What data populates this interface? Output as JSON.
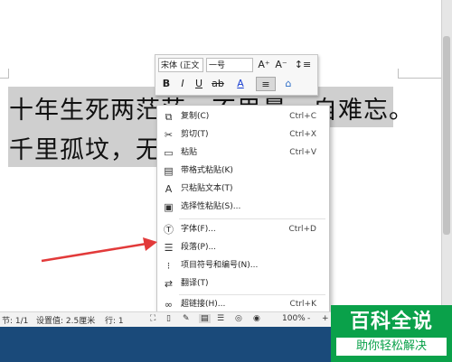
{
  "document": {
    "line1": "十年生死两茫茫，不思量，自难忘。",
    "line2": "千里孤坟，无处话凄凉。"
  },
  "mini_toolbar": {
    "font_name": "宋体 (正文",
    "font_size": "一号",
    "grow_font": "A⁺",
    "shrink_font": "A⁻",
    "bold": "B",
    "italic": "I",
    "underline": "U",
    "strike": "ab",
    "font_color": "A",
    "align": "≡",
    "clear": "⌂"
  },
  "context_menu": {
    "items": [
      {
        "icon": "copy-icon",
        "glyph": "⧉",
        "label": "复制(C)",
        "shortcut": "Ctrl+C"
      },
      {
        "icon": "cut-icon",
        "glyph": "✂",
        "label": "剪切(T)",
        "shortcut": "Ctrl+X"
      },
      {
        "icon": "paste-icon",
        "glyph": "📋",
        "label": "粘贴",
        "shortcut": "Ctrl+V"
      },
      {
        "icon": "paste-with-format-icon",
        "glyph": "▤",
        "label": "带格式粘贴(K)",
        "shortcut": ""
      },
      {
        "icon": "paste-text-only-icon",
        "glyph": "A",
        "label": "只粘贴文本(T)",
        "shortcut": ""
      },
      {
        "icon": "paste-special-icon",
        "glyph": "▣",
        "label": "选择性粘贴(S)...",
        "shortcut": ""
      },
      {
        "icon": "font-icon",
        "glyph": "Ⓣ",
        "label": "字体(F)...",
        "shortcut": "Ctrl+D"
      },
      {
        "icon": "paragraph-icon",
        "glyph": "☰",
        "label": "段落(P)...",
        "shortcut": ""
      },
      {
        "icon": "bullets-numbering-icon",
        "glyph": "⁝",
        "label": "项目符号和编号(N)...",
        "shortcut": ""
      },
      {
        "icon": "translate-icon",
        "glyph": "⇄",
        "label": "翻译(T)",
        "shortcut": ""
      },
      {
        "icon": "hyperlink-icon",
        "glyph": "∞",
        "label": "超链接(H)...",
        "shortcut": "Ctrl+K"
      }
    ]
  },
  "status_bar": {
    "section": "节: 1/1",
    "setting": "设置值: 2.5厘米",
    "row": "行: 1",
    "zoom": "100%",
    "zoom_minus": "-",
    "zoom_plus": "+"
  },
  "watermark": {
    "title": "百科全说",
    "subtitle": "助你轻松解决"
  },
  "colors": {
    "accent_arrow": "#e23a3a",
    "brand_green": "#0aa14a"
  }
}
